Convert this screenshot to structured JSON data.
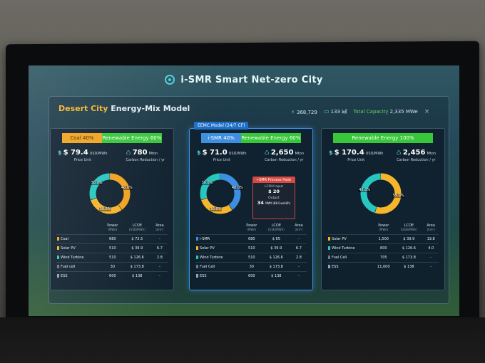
{
  "app": {
    "title": "i-SMR Smart Net-zero City"
  },
  "header": {
    "city": "Desert City",
    "model_label": "Energy-Mix Model",
    "stats": [
      {
        "icon": "bolt-icon",
        "value": "368,729"
      },
      {
        "icon": "area-icon",
        "value": "133 ㎢"
      },
      {
        "label": "Total Capacity",
        "value": "2,335 MWe"
      }
    ],
    "close": "×"
  },
  "colors": {
    "coal": "#f0a21f",
    "renewable": "#38c73a",
    "ismr": "#3e8fe0",
    "solar": "#f6b52b",
    "wind": "#27c7c0",
    "fuel": "#6b7a86",
    "ess": "#8fa3c7"
  },
  "cards": [
    {
      "tag": "",
      "mix": [
        {
          "label": "Coal  40%",
          "color": "#f0a21f",
          "share": 0.4
        },
        {
          "label": "Renewable Energy  60%",
          "color": "#38c73a",
          "share": 0.6
        }
      ],
      "price": {
        "value": "$ 79.4",
        "unit": "USD/MWh",
        "label": "Price Unit"
      },
      "carbon": {
        "value": "780",
        "unit": "Mton",
        "label": "Carbon Reduction / yr"
      },
      "donut": [
        {
          "name": "Coal",
          "pct": 40,
          "label": "40.0%",
          "color": "#f0a21f"
        },
        {
          "name": "Solar PV",
          "pct": 30,
          "label": "30.0%",
          "color": "#f6b52b"
        },
        {
          "name": "Wind Turbine",
          "pct": 30,
          "label": "30.0%",
          "color": "#27c7c0"
        }
      ],
      "columns": [
        "Power",
        "LCOE",
        "Area"
      ],
      "column_units": [
        "(MWe)",
        "(USD/MWh)",
        "(km²)"
      ],
      "rows": [
        {
          "name": "Coal",
          "color": "#f0a21f",
          "power": "680",
          "lcoe": "$ 72.5",
          "area": "-"
        },
        {
          "name": "Solar PV",
          "color": "#f6b52b",
          "power": "510",
          "lcoe": "$ 39.9",
          "area": "6.7"
        },
        {
          "name": "Wind Turbine",
          "color": "#27c7c0",
          "power": "510",
          "lcoe": "$ 126.6",
          "area": "2.8"
        },
        {
          "name": "Fuel cell",
          "color": "#6b7a86",
          "power": "30",
          "lcoe": "$ 173.8",
          "area": "-"
        },
        {
          "name": "ESS",
          "color": "#8fa3c7",
          "power": "600",
          "lcoe": "$ 138",
          "area": "-"
        }
      ]
    },
    {
      "tag": "EEMC Model (24/7 CF)",
      "mix": [
        {
          "label": "i-SMR  40%",
          "color": "#3e8fe0",
          "share": 0.4
        },
        {
          "label": "Renewable Energy  60%",
          "color": "#38c73a",
          "share": 0.6
        }
      ],
      "price": {
        "value": "$ 71.0",
        "unit": "USD/MWh",
        "label": "Price Unit"
      },
      "carbon": {
        "value": "2,650",
        "unit": "Mton",
        "label": "Carbon Reduction / yr"
      },
      "donut": [
        {
          "name": "i-SMR",
          "pct": 40,
          "label": "40.0%",
          "color": "#3e8fe0"
        },
        {
          "name": "Solar PV",
          "pct": 30,
          "label": "30.0%",
          "color": "#f6b52b"
        },
        {
          "name": "Wind Turbine",
          "pct": 30,
          "label": "30.0%",
          "color": "#27c7c0"
        }
      ],
      "process_heat": {
        "title": "i-SMR Process Heat",
        "lcoh_label": "LCOH Input",
        "lcoh_value": "$ 20",
        "output_label": "Output",
        "output_value": "34",
        "output_unit": "MWt (88 GwsH/h)"
      },
      "columns": [
        "Power",
        "LCOE",
        "Area"
      ],
      "column_units": [
        "(MWe)",
        "(USD/MWh)",
        "(km²)"
      ],
      "rows": [
        {
          "name": "i-SMR",
          "color": "#3e8fe0",
          "power": "680",
          "lcoe": "$ 65",
          "area": "-"
        },
        {
          "name": "Solar PV",
          "color": "#f6b52b",
          "power": "510",
          "lcoe": "$ 39.9",
          "area": "6.7"
        },
        {
          "name": "Wind Turbine",
          "color": "#27c7c0",
          "power": "510",
          "lcoe": "$ 126.6",
          "area": "2.8"
        },
        {
          "name": "Fuel Cell",
          "color": "#6b7a86",
          "power": "30",
          "lcoe": "$ 173.8",
          "area": "-"
        },
        {
          "name": "ESS",
          "color": "#8fa3c7",
          "power": "600",
          "lcoe": "$ 138",
          "area": "-"
        }
      ]
    },
    {
      "tag": "",
      "mix": [
        {
          "label": "Renewable Energy  100%",
          "color": "#38c73a",
          "share": 1.0
        }
      ],
      "price": {
        "value": "$ 170.4",
        "unit": "USD/MWh",
        "label": "Price Unit"
      },
      "carbon": {
        "value": "2,456",
        "unit": "Mton",
        "label": "Carbon Reduction / yr"
      },
      "donut": [
        {
          "name": "Solar PV",
          "pct": 55,
          "label": "55.0%",
          "color": "#f6b52b"
        },
        {
          "name": "Wind Turbine",
          "pct": 45,
          "label": "45.0%",
          "color": "#27c7c0"
        }
      ],
      "columns": [
        "Power",
        "LCOE",
        "Area"
      ],
      "column_units": [
        "(MWe)",
        "(USD/MWh)",
        "(km²)"
      ],
      "rows": [
        {
          "name": "Solar PV",
          "color": "#f6b52b",
          "power": "1,500",
          "lcoe": "$ 39.9",
          "area": "19.8"
        },
        {
          "name": "Wind Turbine",
          "color": "#27c7c0",
          "power": "800",
          "lcoe": "$ 126.6",
          "area": "4.0"
        },
        {
          "name": "Fuel Cell",
          "color": "#6b7a86",
          "power": "705",
          "lcoe": "$ 173.8",
          "area": "-"
        },
        {
          "name": "ESS",
          "color": "#8fa3c7",
          "power": "11,000",
          "lcoe": "$ 138",
          "area": "-"
        }
      ]
    }
  ]
}
